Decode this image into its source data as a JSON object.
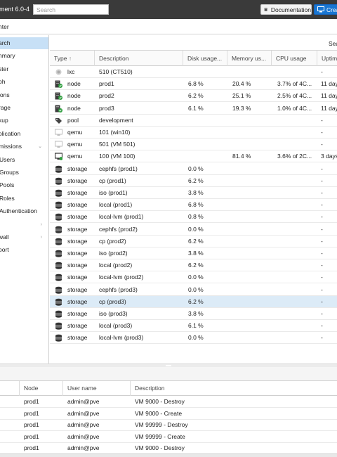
{
  "topbar": {
    "product": "ment 6.0-4",
    "search_placeholder": "Search",
    "documentation_label": "Documentation",
    "create_label": "Crea"
  },
  "view": {
    "label": "nter"
  },
  "sidenav": {
    "items": [
      {
        "label": "arch",
        "active": true
      },
      {
        "label": "nmary"
      },
      {
        "label": "ster"
      },
      {
        "label": "ph"
      },
      {
        "label": "ions"
      },
      {
        "label": "rage"
      },
      {
        "label": "kup"
      },
      {
        "label": "olication"
      },
      {
        "label": "missions"
      },
      {
        "label": "Users"
      },
      {
        "label": "Groups"
      },
      {
        "label": "Pools"
      },
      {
        "label": "Roles"
      },
      {
        "label": "Authentication"
      },
      {
        "label": ""
      },
      {
        "label": "wall"
      },
      {
        "label": "port"
      }
    ]
  },
  "search_panel": {
    "search_label": "Sea",
    "columns": [
      "Type",
      "Description",
      "Disk usage...",
      "Memory us...",
      "CPU usage",
      "Uptim"
    ],
    "sort_indicator": "↑",
    "rows": [
      {
        "icon": "lxc-icon",
        "type": "lxc",
        "desc": "510 (CT510)",
        "disk": "",
        "mem": "",
        "cpu": "",
        "up": "-"
      },
      {
        "icon": "node-icon",
        "type": "node",
        "desc": "prod1",
        "disk": "6.8 %",
        "mem": "20.4 %",
        "cpu": "3.7% of 4C...",
        "up": "11 day"
      },
      {
        "icon": "node-icon",
        "type": "node",
        "desc": "prod2",
        "disk": "6.2 %",
        "mem": "25.1 %",
        "cpu": "2.5% of 4C...",
        "up": "11 day"
      },
      {
        "icon": "node-icon",
        "type": "node",
        "desc": "prod3",
        "disk": "6.1 %",
        "mem": "19.3 %",
        "cpu": "1.0% of 4C...",
        "up": "11 day"
      },
      {
        "icon": "pool-icon",
        "type": "pool",
        "desc": "development",
        "disk": "",
        "mem": "",
        "cpu": "",
        "up": "-"
      },
      {
        "icon": "qemu-icon",
        "type": "qemu",
        "desc": "101 (win10)",
        "disk": "",
        "mem": "",
        "cpu": "",
        "up": "-"
      },
      {
        "icon": "qemu-icon",
        "type": "qemu",
        "desc": "501 (VM 501)",
        "disk": "",
        "mem": "",
        "cpu": "",
        "up": "-"
      },
      {
        "icon": "qemu-running-icon",
        "type": "qemu",
        "desc": "100 (VM 100)",
        "disk": "",
        "mem": "81.4 %",
        "cpu": "3.6% of 2C...",
        "up": "3 days"
      },
      {
        "icon": "storage-icon",
        "type": "storage",
        "desc": "cephfs (prod1)",
        "disk": "0.0 %",
        "mem": "",
        "cpu": "",
        "up": "-"
      },
      {
        "icon": "storage-icon",
        "type": "storage",
        "desc": "cp (prod1)",
        "disk": "6.2 %",
        "mem": "",
        "cpu": "",
        "up": "-"
      },
      {
        "icon": "storage-icon",
        "type": "storage",
        "desc": "iso (prod1)",
        "disk": "3.8 %",
        "mem": "",
        "cpu": "",
        "up": "-"
      },
      {
        "icon": "storage-icon",
        "type": "storage",
        "desc": "local (prod1)",
        "disk": "6.8 %",
        "mem": "",
        "cpu": "",
        "up": "-"
      },
      {
        "icon": "storage-icon",
        "type": "storage",
        "desc": "local-lvm (prod1)",
        "disk": "0.8 %",
        "mem": "",
        "cpu": "",
        "up": "-"
      },
      {
        "icon": "storage-icon",
        "type": "storage",
        "desc": "cephfs (prod2)",
        "disk": "0.0 %",
        "mem": "",
        "cpu": "",
        "up": "-"
      },
      {
        "icon": "storage-icon",
        "type": "storage",
        "desc": "cp (prod2)",
        "disk": "6.2 %",
        "mem": "",
        "cpu": "",
        "up": "-"
      },
      {
        "icon": "storage-icon",
        "type": "storage",
        "desc": "iso (prod2)",
        "disk": "3.8 %",
        "mem": "",
        "cpu": "",
        "up": "-"
      },
      {
        "icon": "storage-icon",
        "type": "storage",
        "desc": "local (prod2)",
        "disk": "6.2 %",
        "mem": "",
        "cpu": "",
        "up": "-"
      },
      {
        "icon": "storage-icon",
        "type": "storage",
        "desc": "local-lvm (prod2)",
        "disk": "0.0 %",
        "mem": "",
        "cpu": "",
        "up": "-"
      },
      {
        "icon": "storage-icon",
        "type": "storage",
        "desc": "cephfs (prod3)",
        "disk": "0.0 %",
        "mem": "",
        "cpu": "",
        "up": "-"
      },
      {
        "icon": "storage-icon",
        "type": "storage",
        "desc": "cp (prod3)",
        "disk": "6.2 %",
        "mem": "",
        "cpu": "",
        "up": "-",
        "selected": true
      },
      {
        "icon": "storage-icon",
        "type": "storage",
        "desc": "iso (prod3)",
        "disk": "3.8 %",
        "mem": "",
        "cpu": "",
        "up": "-"
      },
      {
        "icon": "storage-icon",
        "type": "storage",
        "desc": "local (prod3)",
        "disk": "6.1 %",
        "mem": "",
        "cpu": "",
        "up": "-"
      },
      {
        "icon": "storage-icon",
        "type": "storage",
        "desc": "local-lvm (prod3)",
        "disk": "0.0 %",
        "mem": "",
        "cpu": "",
        "up": "-"
      }
    ]
  },
  "tasks": {
    "columns": [
      "Node",
      "User name",
      "Description"
    ],
    "rows": [
      {
        "node": "prod1",
        "user": "admin@pve",
        "desc": "VM 9000 - Destroy"
      },
      {
        "node": "prod1",
        "user": "admin@pve",
        "desc": "VM 9000 - Create"
      },
      {
        "node": "prod1",
        "user": "admin@pve",
        "desc": "VM 99999 - Destroy"
      },
      {
        "node": "prod1",
        "user": "admin@pve",
        "desc": "VM 99999 - Create"
      },
      {
        "node": "prod1",
        "user": "admin@pve",
        "desc": "VM 9000 - Destroy"
      }
    ]
  },
  "colors": {
    "topbar_bg": "#3a3a3a",
    "accent": "#1976d2",
    "selection": "#c7e0f6",
    "node_status_ok": "#2e9e3e"
  }
}
